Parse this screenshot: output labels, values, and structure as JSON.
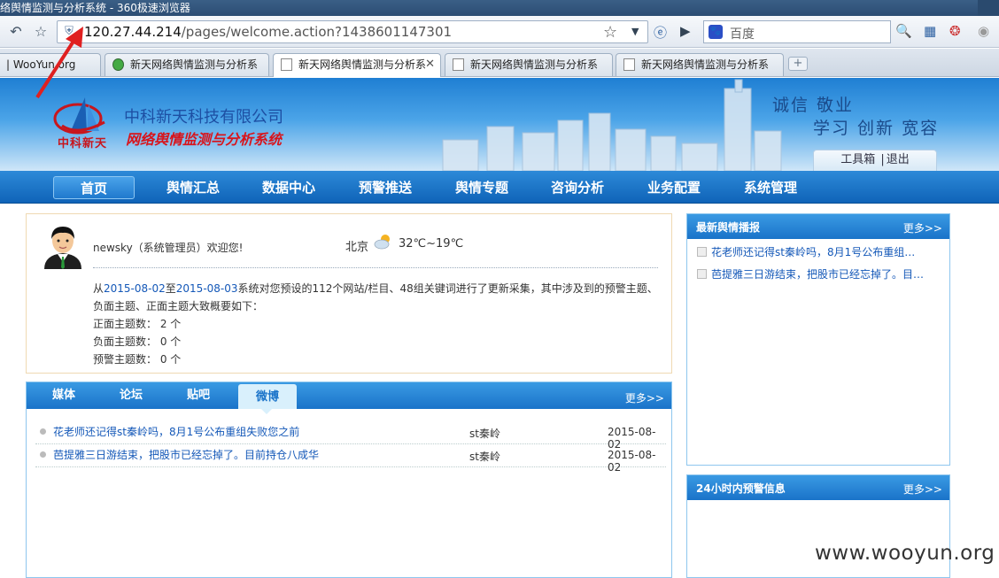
{
  "window": {
    "title": "络舆情监测与分析系统 - 360极速浏览器"
  },
  "browser": {
    "url_host": "120.27.44.214",
    "url_path": "/pages/welcome.action?1438601147301",
    "search_placeholder": "百度",
    "tabs": [
      {
        "label": "| WooYun.org"
      },
      {
        "label": "新天网络舆情监测与分析系"
      },
      {
        "label": "新天网络舆情监测与分析系"
      },
      {
        "label": "新天网络舆情监测与分析系"
      },
      {
        "label": "新天网络舆情监测与分析系"
      }
    ],
    "active_tab_index": 2
  },
  "header": {
    "logo_text": "中科新天",
    "company": "中科新天科技有限公司",
    "system_name": "网络舆情监测与分析系统",
    "motto_line1": "诚信 敬业",
    "motto_line2": "学习 创新 宽容",
    "toolbox": "工具箱",
    "separator": "|",
    "logout": "退出"
  },
  "nav": {
    "items": [
      "首页",
      "舆情汇总",
      "数据中心",
      "预警推送",
      "舆情专题",
      "咨询分析",
      "业务配置",
      "系统管理"
    ],
    "active_index": 0
  },
  "welcome": {
    "greeting": "newsky（系统管理员）欢迎您!",
    "city": "北京",
    "temperature": "32℃~19℃",
    "summary_prefix": "从",
    "date_from": "2015-08-02",
    "summary_to": "至",
    "date_to": "2015-08-03",
    "summary_rest": "系统对您预设的112个网站/栏目、48组关键词进行了更新采集，其中涉及到的预警主题、负面主题、正面主题大致概要如下：",
    "positive_label": "正面主题数：",
    "positive_value": "2 个",
    "negative_label": "负面主题数：",
    "negative_value": "0 个",
    "warning_label": "预警主题数：",
    "warning_value": "0 个"
  },
  "news": {
    "tabs": [
      "媒体",
      "论坛",
      "贴吧",
      "微博"
    ],
    "active_tab_index": 3,
    "more": "更多>>",
    "rows": [
      {
        "title": "花老师还记得st秦岭吗，8月1号公布重组失败您之前",
        "source": "st秦岭",
        "date": "2015-08-02"
      },
      {
        "title": "芭提雅三日游结束，把股市已经忘掉了。目前持仓八成华",
        "source": "st秦岭",
        "date": "2015-08-02"
      }
    ]
  },
  "latest_briefs": {
    "title": "最新舆情播报",
    "more": "更多>>",
    "items": [
      "花老师还记得st秦岭吗，8月1号公布重组…",
      "芭提雅三日游结束，把股市已经忘掉了。目…"
    ]
  },
  "alerts": {
    "title": "24小时内预警信息",
    "more": "更多>>"
  },
  "watermark": "www.wooyun.org",
  "colors": {
    "nav_blue": "#1a73c9",
    "link_blue": "#1458b8",
    "brand_red": "#d8141b"
  }
}
